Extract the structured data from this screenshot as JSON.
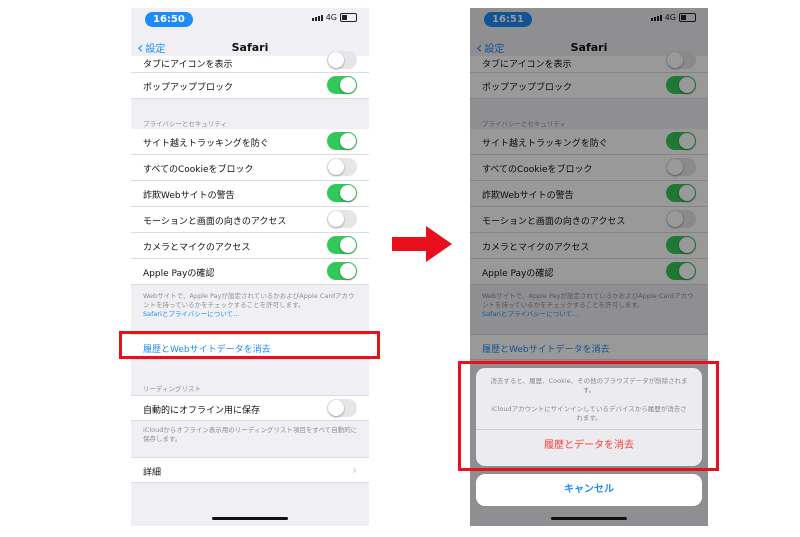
{
  "left": {
    "time": "16:50",
    "network": "4G",
    "back_label": "設定",
    "title": "Safari",
    "rows": {
      "partial": "タブにアイコンを表示",
      "popup": "ポップアップブロック",
      "cross_site": "サイト越えトラッキングを防ぐ",
      "cookies": "すべてのCookieをブロック",
      "fraud": "詐欺Webサイトの警告",
      "motion": "モーションと画面の向きのアクセス",
      "camera": "カメラとマイクのアクセス",
      "applepay": "Apple Payの確認"
    },
    "privacy_header": "プライバシーとセキュリティ",
    "privacy_footnote": "Webサイトで、Apple Payが設定されているかおよびApple Cardアカウントを持っているかをチェックすることを許可します。",
    "privacy_link": "Safariとプライバシーについて…",
    "clear_history": "履歴とWebサイトデータを消去",
    "reading_list_header": "リーディングリスト",
    "offline_label": "自動的にオフライン用に保存",
    "offline_footnote": "iCloudからオフライン表示用のリーディングリスト項目をすべて自動的に保存します。",
    "details_label": "詳細"
  },
  "right": {
    "time": "16:51",
    "network": "4G",
    "back_label": "設定",
    "title": "Safari",
    "rows": {
      "partial": "タブにアイコンを表示",
      "popup": "ポップアップブロック",
      "cross_site": "サイト越えトラッキングを防ぐ",
      "cookies": "すべてのCookieをブロック",
      "fraud": "詐欺Webサイトの警告",
      "motion": "モーションと画面の向きのアクセス",
      "camera": "カメラとマイクのアクセス",
      "applepay": "Apple Payの確認"
    },
    "privacy_header": "プライバシーとセキュリティ",
    "privacy_footnote": "Webサイトで、Apple Payが設定されているかおよびApple Cardアカウントを持っているかをチェックすることを許可します。",
    "privacy_link": "Safariとプライバシーについて…",
    "clear_history": "履歴とWebサイトデータを消去",
    "sheet_message_1": "消去すると、履歴、Cookie、その他のブラウズデータが削除されます。",
    "sheet_message_2": "iCloudアカウントにサインインしているデバイスから履歴が消去されます。",
    "sheet_confirm": "履歴とデータを消去",
    "sheet_cancel": "キャンセル"
  },
  "toggles": {
    "popup": true,
    "cross_site": true,
    "cookies": false,
    "fraud": true,
    "motion": false,
    "camera": true,
    "applepay": true,
    "offline": false
  },
  "colors": {
    "highlight_box": "#e8101a",
    "arrow": "#e8101a",
    "toggle_on": "#34c759",
    "link": "#1d8cf8",
    "destructive": "#ff3b30"
  }
}
